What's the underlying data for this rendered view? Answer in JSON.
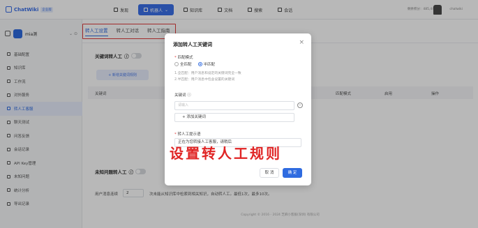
{
  "app": {
    "logo": "ChatWiki",
    "badge": "企业版"
  },
  "nav": [
    {
      "label": "发现"
    },
    {
      "label": "机器人"
    },
    {
      "label": "知识库"
    },
    {
      "label": "文档"
    },
    {
      "label": "搜索"
    },
    {
      "label": "会话"
    }
  ],
  "header": {
    "balance": "剩余积分：485,444",
    "user": "chatwiki"
  },
  "workspace": {
    "name": "mia测"
  },
  "sidebar": {
    "items": [
      {
        "label": "基础配置"
      },
      {
        "label": "知识库"
      },
      {
        "label": "工作流"
      },
      {
        "label": "对外服务"
      },
      {
        "label": "转人工客服"
      },
      {
        "label": "聊天测试"
      },
      {
        "label": "问答反馈"
      },
      {
        "label": "会话记录"
      },
      {
        "label": "API Key管理"
      },
      {
        "label": "未知问题"
      },
      {
        "label": "统计分析"
      },
      {
        "label": "导出记录"
      }
    ]
  },
  "tabs": [
    {
      "label": "转人工设置"
    },
    {
      "label": "转人工对话"
    },
    {
      "label": "转人工指南"
    }
  ],
  "main": {
    "keyword_section": "关键词转人工",
    "add_button": "+ 新增关键词规则",
    "table_headers": [
      "关键词",
      "匹配模式",
      "启用",
      "操作"
    ],
    "unknown_section": "未知问题转人工",
    "rule_prefix": "用户消息连续",
    "rule_count": "2",
    "rule_suffix": "次未能从知识库中检索到相关知识，自动转人工。最低1次，最多10次。",
    "footer": "Copyright © 2016 - 2024 芝麻小客服(深圳) 有限公司"
  },
  "modal": {
    "title": "添加转人工关键词",
    "match_label": "匹配模式",
    "options": [
      {
        "label": "全匹配",
        "checked": false
      },
      {
        "label": "半匹配",
        "checked": true
      }
    ],
    "hint1": "1.全匹配：用户消息和设定的关键词完全一致",
    "hint2": "2.半匹配：用户消息中包含设置的关键词",
    "keyword_label": "关键词",
    "keyword_placeholder": "请输入",
    "add_keyword": "+ 添加关键词",
    "prompt_label": "转人工提示语",
    "prompt_value": "正在为您转接人工客服，请稍后",
    "cancel": "取 消",
    "ok": "确 定"
  },
  "caption": "设置转人工规则",
  "colors": {
    "accent": "#2f6be0",
    "annotation": "#e02424"
  }
}
